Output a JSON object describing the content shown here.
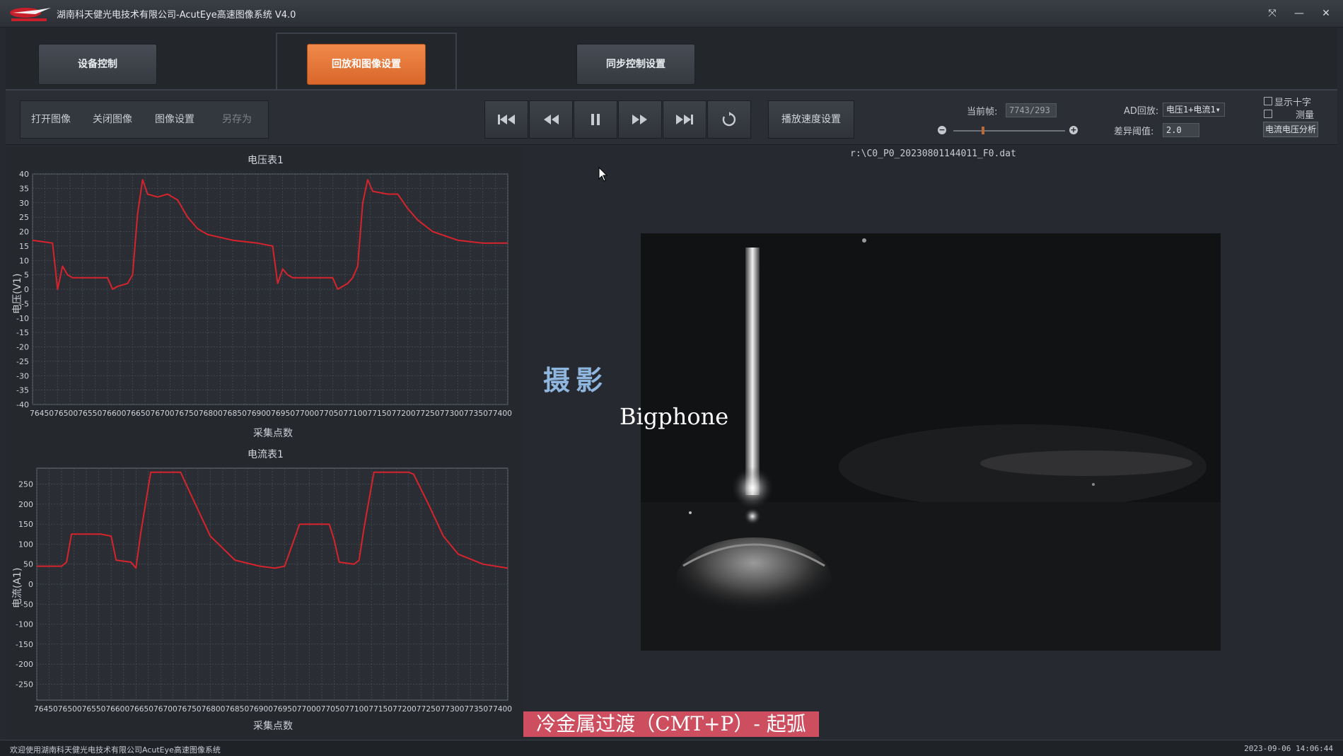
{
  "window": {
    "title": "湖南科天健光电技术有限公司-AcutEye高速图像系统 V4.0",
    "controls": [
      "⤧",
      "—",
      "✕"
    ]
  },
  "main_nav": {
    "tabs": [
      {
        "label": "设备控制"
      },
      {
        "label": "回放和图像设置"
      },
      {
        "label": "同步控制设置"
      }
    ],
    "active_tab": "回放和图像设置",
    "accent": "#e8763a"
  },
  "toolbar": {
    "file_buttons": [
      "打开图像",
      "关闭图像",
      "图像设置",
      "另存为"
    ],
    "playback_icons": [
      "skip-to-start-icon",
      "rewind-icon",
      "pause-icon",
      "fast-forward-icon",
      "skip-to-end-icon",
      "loop-icon"
    ],
    "speed_button": "播放速度设置",
    "current_frame_label": "当前帧:",
    "current_frame_value": "7743/293",
    "slider_minus": "−",
    "slider_plus": "+",
    "ad_playback_label": "AD回放:",
    "ad_playback_value": "电压1+电流1▾",
    "diff_threshold_label": "差异阈值:",
    "diff_threshold_value": "2.0",
    "show_crosshair_label": "显示十字",
    "measure_label": "测量",
    "analysis_button": "电流电压分析"
  },
  "file_path": "r:\\C0_P0_20230801144011_F0.dat",
  "watermark": {
    "line1": "摄影",
    "line2": "Bigphone"
  },
  "caption": "冷金属过渡（CMT+P）- 起弧",
  "status": {
    "left": "欢迎使用湖南科天健光电技术有限公司AcutEye高速图像系统",
    "right": "2023-09-06 14:06:44"
  },
  "chart_data": [
    {
      "type": "line",
      "title": "电压表1",
      "xlabel": "采集点数",
      "ylabel": "电压(V1)",
      "ylim": [
        -40,
        40
      ],
      "yticks": [
        40,
        35,
        30,
        25,
        20,
        15,
        10,
        5,
        0,
        -5,
        -10,
        -15,
        -20,
        -25,
        -30,
        -35,
        -40
      ],
      "xlim": [
        76450,
        77400
      ],
      "xtick_text": "7645076500765507660076650767007675076800768507690076950770007705077100771507720077250773007735077400",
      "line_color": "#d6232c",
      "grid": true,
      "series": [
        {
          "x": [
            76450,
            76490,
            76500,
            76510,
            76520,
            76530,
            76560,
            76600,
            76610,
            76620,
            76640,
            76650,
            76660,
            76670,
            76680,
            76700,
            76720,
            76740,
            76760,
            76780,
            76800,
            76850,
            76900,
            76930,
            76940,
            76950,
            76960,
            76970,
            77000,
            77050,
            77060,
            77080,
            77090,
            77100,
            77110,
            77120,
            77130,
            77160,
            77180,
            77200,
            77220,
            77250,
            77300,
            77350,
            77400
          ],
          "y": [
            17,
            16,
            0,
            8,
            5,
            4,
            4,
            4,
            0,
            1,
            2,
            5,
            26,
            38,
            33,
            32,
            33,
            31,
            25,
            21,
            19,
            17,
            16,
            15,
            2,
            7,
            5,
            4,
            4,
            4,
            0,
            2,
            4,
            8,
            30,
            38,
            34,
            33,
            33,
            28,
            24,
            20,
            17,
            16,
            16
          ]
        }
      ]
    },
    {
      "type": "line",
      "title": "电流表1",
      "xlabel": "采集点数",
      "ylabel": "电流(A1)",
      "ylim": [
        -290,
        290
      ],
      "yticks": [
        250,
        200,
        150,
        100,
        50,
        0,
        -50,
        -100,
        -150,
        -200,
        -250
      ],
      "xlim": [
        76450,
        77400
      ],
      "xtick_text": "7645076500765507660076650767007675076800768507690076950770007705077100771507720077250773007735077400",
      "line_color": "#d6232c",
      "grid": true,
      "series": [
        {
          "x": [
            76450,
            76500,
            76510,
            76520,
            76580,
            76600,
            76610,
            76640,
            76650,
            76660,
            76680,
            76700,
            76710,
            76740,
            76770,
            76800,
            76850,
            76900,
            76930,
            76950,
            76960,
            76980,
            77040,
            77050,
            77060,
            77090,
            77100,
            77110,
            77130,
            77200,
            77210,
            77240,
            77270,
            77300,
            77350,
            77400
          ],
          "y": [
            45,
            45,
            55,
            125,
            125,
            120,
            60,
            55,
            40,
            130,
            280,
            280,
            280,
            280,
            200,
            120,
            60,
            45,
            40,
            45,
            80,
            150,
            150,
            110,
            55,
            50,
            60,
            140,
            280,
            280,
            275,
            200,
            120,
            75,
            50,
            40
          ]
        }
      ]
    }
  ]
}
